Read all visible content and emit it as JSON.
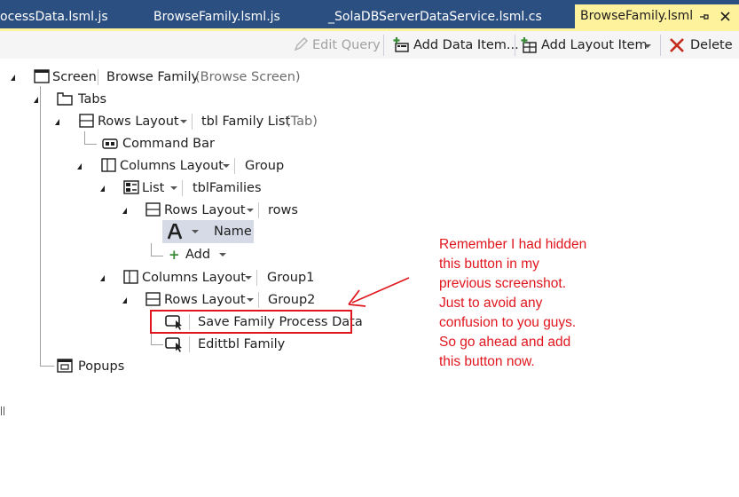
{
  "tabs": [
    {
      "label": "ocessData.lsml.js",
      "active": false
    },
    {
      "label": "BrowseFamily.lsml.js",
      "active": false
    },
    {
      "label": "_SolaDBServerDataService.lsml.cs",
      "active": false
    },
    {
      "label": "BrowseFamily.lsml",
      "active": true
    }
  ],
  "tab_icons": {
    "pin": "pin-icon",
    "close": "close-icon"
  },
  "toolbar": {
    "edit_query": "Edit Query",
    "add_data_item": "Add Data Item...",
    "add_layout_item": "Add Layout Item",
    "delete": "Delete"
  },
  "tree": {
    "screen": {
      "label": "Screen",
      "value": "Browse Family",
      "note": "(Browse Screen)"
    },
    "tabs": {
      "label": "Tabs"
    },
    "rows_layout_1": {
      "label": "Rows Layout",
      "value": "tbl Family List",
      "note": "(Tab)"
    },
    "command_bar": {
      "label": "Command Bar"
    },
    "columns_layout_1": {
      "label": "Columns Layout",
      "value": "Group"
    },
    "list": {
      "label": "List",
      "value": "tblFamilies"
    },
    "rows_layout_2": {
      "label": "Rows Layout",
      "value": "rows"
    },
    "name_item": {
      "label": "Name"
    },
    "add_item": {
      "label": "Add"
    },
    "columns_layout_2": {
      "label": "Columns Layout",
      "value": "Group1"
    },
    "rows_layout_3": {
      "label": "Rows Layout",
      "value": "Group2"
    },
    "save_button": {
      "label": "Save Family Process Data"
    },
    "edit_button": {
      "label": "Edittbl Family"
    },
    "popups": {
      "label": "Popups"
    }
  },
  "annotation": {
    "lines": [
      "Remember I had hidden",
      "this button in my",
      "previous screenshot.",
      "Just to avoid any",
      "confusion to you guys.",
      "So go ahead and add",
      "this button now."
    ]
  },
  "colors": {
    "tabstrip": "#2b4f81",
    "active_tab": "#fff29d",
    "annotation": "#e0161e",
    "selection": "#d6d9e6"
  }
}
